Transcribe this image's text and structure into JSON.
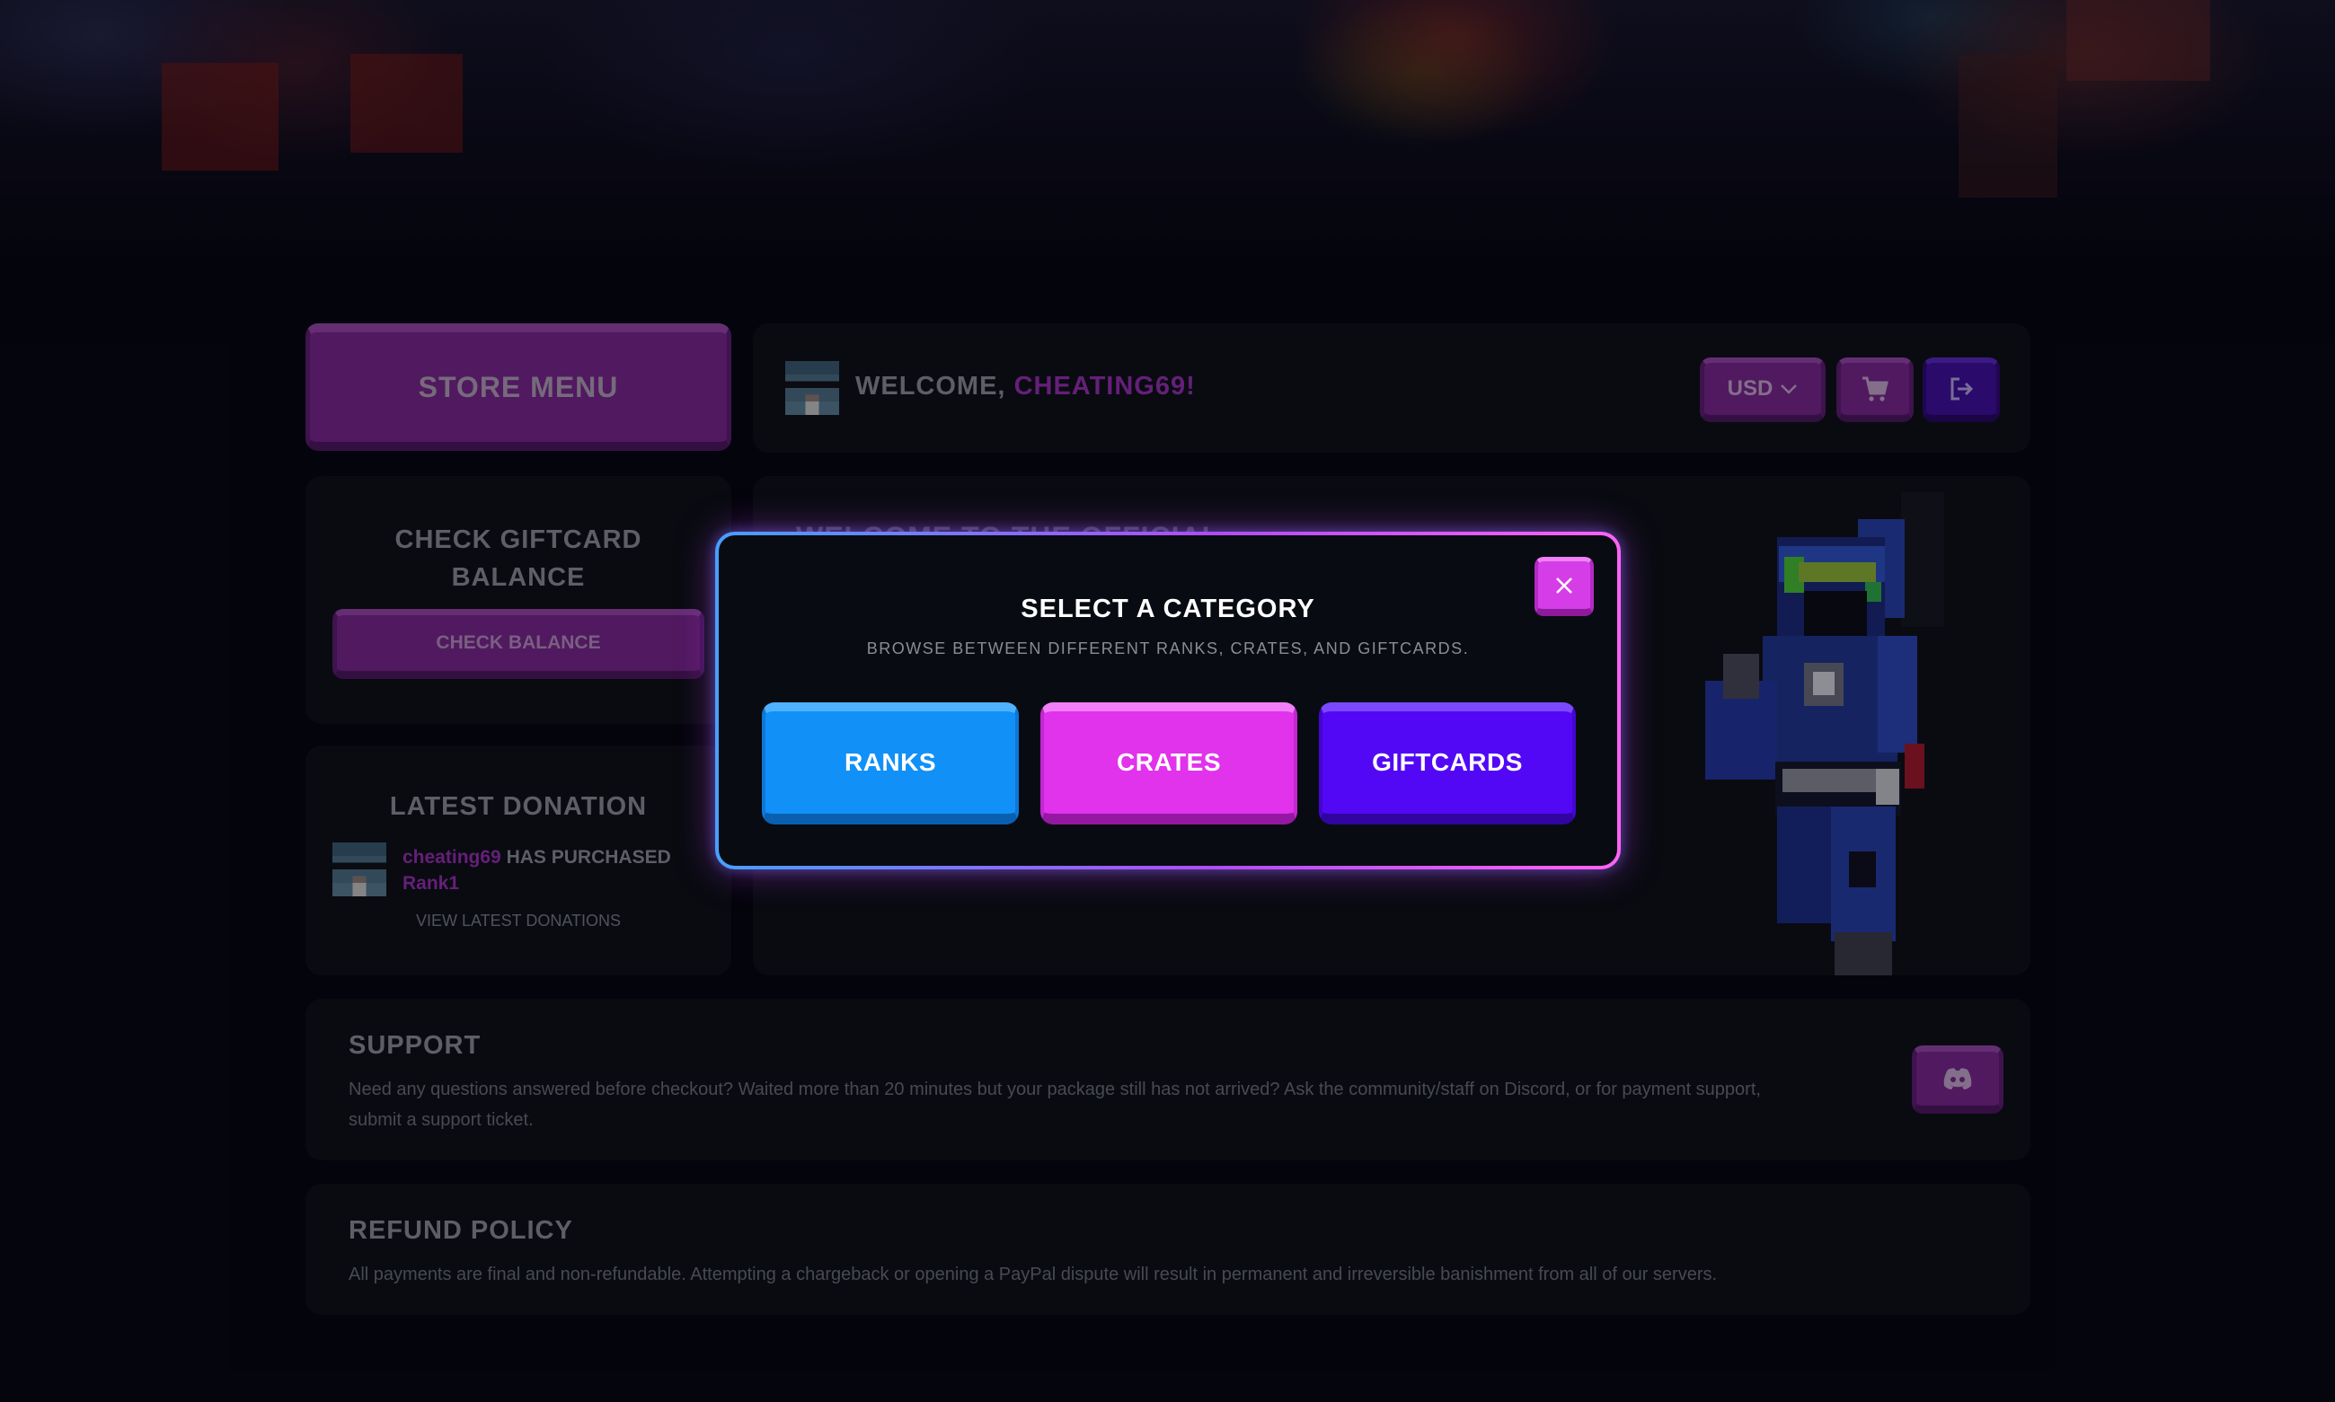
{
  "colors": {
    "accent_purple": "#7b2590",
    "username_purple": "#9a2fb5",
    "ranks_blue": "#1190f7",
    "crates_magenta": "#e132ec",
    "giftcards_violet": "#5308f5",
    "card_bg": "#0d1016",
    "page_bg": "#06060f"
  },
  "sidebar": {
    "store_menu_label": "STORE MENU",
    "giftcard": {
      "title_line1": "CHECK GIFTCARD",
      "title_line2": "BALANCE",
      "button_label": "CHECK BALANCE"
    },
    "latest_donation": {
      "title": "LATEST DONATION",
      "username": "cheating69",
      "action": "HAS PURCHASED",
      "package": "Rank1",
      "view_link": "VIEW LATEST DONATIONS"
    }
  },
  "header": {
    "welcome_prefix": "WELCOME,",
    "username": "CHEATING69!",
    "currency": "USD",
    "icons": [
      "chevron-down-icon",
      "cart-icon",
      "logout-icon"
    ]
  },
  "main": {
    "hero_title_partial": "WELCOME TO THE OFFICIAL"
  },
  "modal": {
    "title": "SELECT A CATEGORY",
    "subtitle": "BROWSE BETWEEN DIFFERENT RANKS, CRATES, AND GIFTCARDS.",
    "categories": [
      {
        "label": "RANKS"
      },
      {
        "label": "CRATES"
      },
      {
        "label": "GIFTCARDS"
      }
    ]
  },
  "support": {
    "title": "SUPPORT",
    "text_line1": "Need any questions answered before checkout? Waited more than 20 minutes but your package still has not arrived? Ask the community/staff on Discord, or for payment support,",
    "text_line2": "submit a support ticket.",
    "icon": "discord-icon"
  },
  "refund": {
    "title": "REFUND POLICY",
    "text": "All payments are final and non-refundable. Attempting a chargeback or opening a PayPal dispute will result in permanent and irreversible banishment from all of our servers."
  }
}
